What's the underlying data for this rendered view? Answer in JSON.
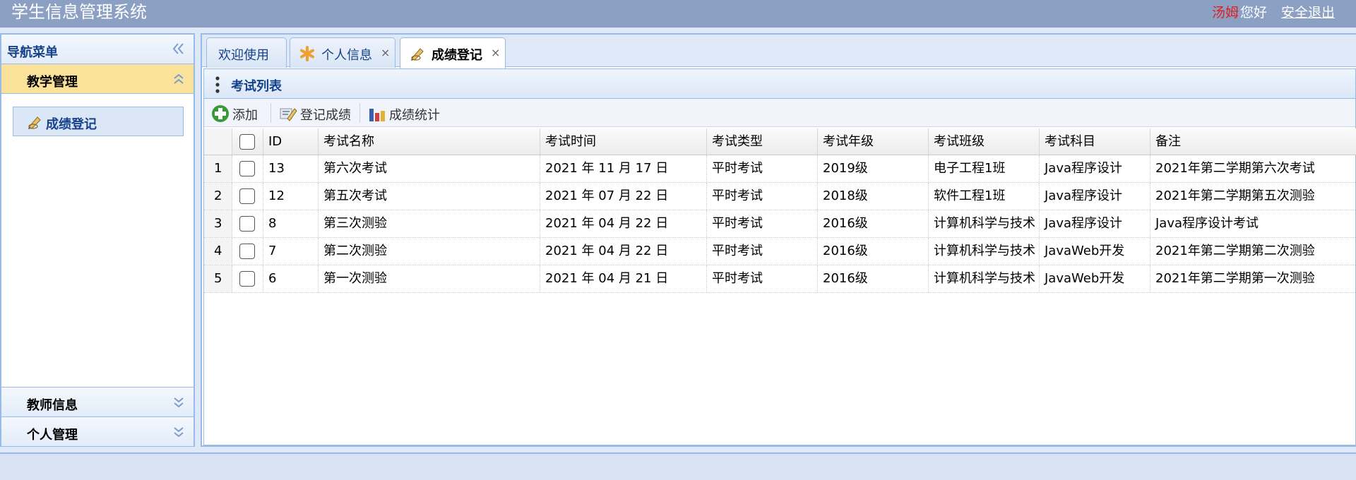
{
  "header": {
    "title": "学生信息管理系统",
    "user_name": "汤姆",
    "greeting": "您好",
    "logout": "安全退出"
  },
  "nav": {
    "title": "导航菜单",
    "sections": [
      {
        "label": "教学管理",
        "expanded": true,
        "items": [
          {
            "label": "成绩登记",
            "icon": "pencil-icon"
          }
        ]
      },
      {
        "label": "教师信息",
        "expanded": false
      },
      {
        "label": "个人管理",
        "expanded": false
      }
    ]
  },
  "tabs": [
    {
      "label": "欢迎使用",
      "closable": false,
      "icon": null
    },
    {
      "label": "个人信息",
      "closable": true,
      "icon": "asterisk-icon"
    },
    {
      "label": "成绩登记",
      "closable": true,
      "icon": "pencil-icon",
      "active": true
    }
  ],
  "tab_close_glyph": "×",
  "panel": {
    "title": "考试列表"
  },
  "toolbar": {
    "add": "添加",
    "register": "登记成绩",
    "stats": "成绩统计"
  },
  "grid": {
    "columns": [
      "ID",
      "考试名称",
      "考试时间",
      "考试类型",
      "考试年级",
      "考试班级",
      "考试科目",
      "备注"
    ],
    "rows": [
      {
        "rn": "1",
        "cells": [
          "13",
          "第六次考试",
          "2021 年 11 月 17 日",
          "平时考试",
          "2019级",
          "电子工程1班",
          "Java程序设计",
          "2021年第二学期第六次考试"
        ]
      },
      {
        "rn": "2",
        "cells": [
          "12",
          "第五次考试",
          "2021 年 07 月 22 日",
          "平时考试",
          "2018级",
          "软件工程1班",
          "Java程序设计",
          "2021年第二学期第五次测验"
        ]
      },
      {
        "rn": "3",
        "cells": [
          "8",
          "第三次测验",
          "2021 年 04 月 22 日",
          "平时考试",
          "2016级",
          "计算机科学与技术",
          "Java程序设计",
          "Java程序设计考试"
        ]
      },
      {
        "rn": "4",
        "cells": [
          "7",
          "第二次测验",
          "2021 年 04 月 22 日",
          "平时考试",
          "2016级",
          "计算机科学与技术",
          "JavaWeb开发",
          "2021年第二学期第二次测验"
        ]
      },
      {
        "rn": "5",
        "cells": [
          "6",
          "第一次测验",
          "2021 年 04 月 21 日",
          "平时考试",
          "2016级",
          "计算机科学与技术",
          "JavaWeb开发",
          "2021年第二学期第一次测验"
        ]
      }
    ]
  },
  "colors": {
    "header_bg": "#8ba0c2",
    "border": "#99bbe8",
    "active_section": "#fbe29a",
    "user_name": "#e02020"
  }
}
